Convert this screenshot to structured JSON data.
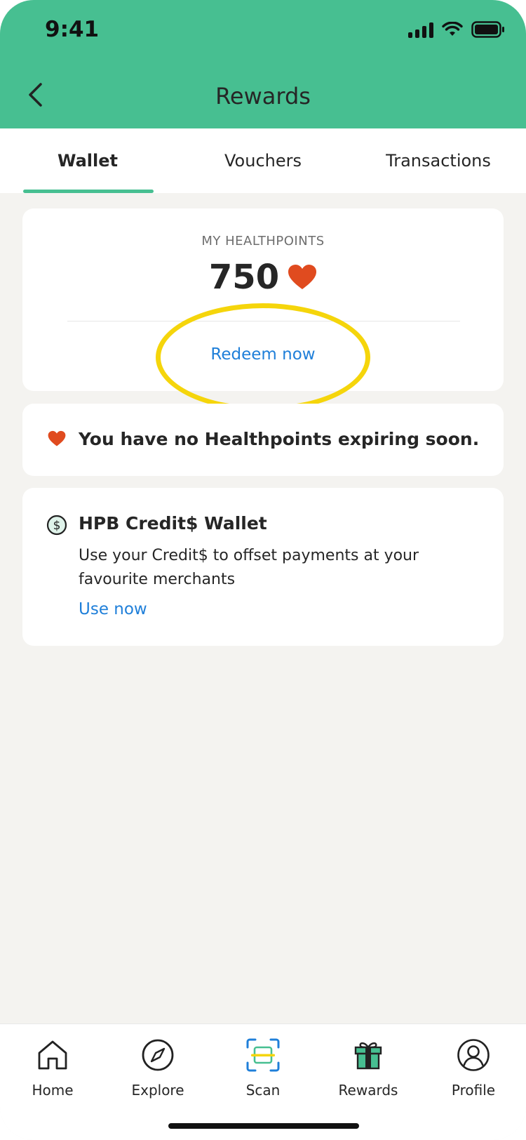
{
  "status_bar": {
    "time": "9:41"
  },
  "header": {
    "title": "Rewards"
  },
  "tabs": [
    {
      "label": "Wallet",
      "active": true
    },
    {
      "label": "Vouchers",
      "active": false
    },
    {
      "label": "Transactions",
      "active": false
    }
  ],
  "points_card": {
    "label": "MY HEALTHPOINTS",
    "value": "750",
    "redeem_label": "Redeem now"
  },
  "expiry_card": {
    "text": "You have no Healthpoints expiring soon."
  },
  "wallet_card": {
    "title": "HPB Credit$ Wallet",
    "description": "Use your Credit$ to offset payments at your favourite merchants",
    "action_label": "Use now"
  },
  "bottom_nav": [
    {
      "label": "Home",
      "icon": "home-icon"
    },
    {
      "label": "Explore",
      "icon": "compass-icon"
    },
    {
      "label": "Scan",
      "icon": "scan-icon"
    },
    {
      "label": "Rewards",
      "icon": "gift-icon"
    },
    {
      "label": "Profile",
      "icon": "profile-icon"
    }
  ],
  "colors": {
    "brand_green": "#47bf91",
    "link_blue": "#1f7fd9",
    "heart_red": "#e04b1f",
    "highlight_yellow": "#f5d50b"
  }
}
